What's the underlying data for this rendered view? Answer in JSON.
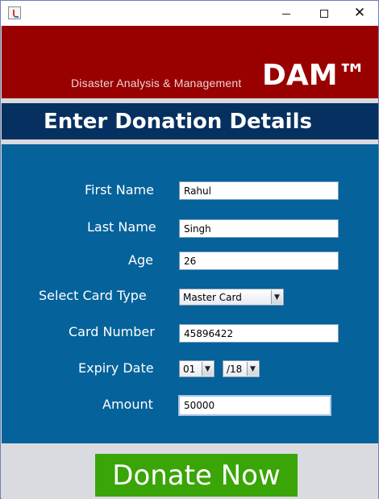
{
  "window": {
    "minimize_icon": "minimize-icon",
    "maximize_icon": "maximize-icon",
    "close_icon": "close-icon",
    "close_glyph": "✕"
  },
  "header": {
    "subtitle": "Disaster Analysis & Management",
    "logo": "DAM™",
    "color": "#990000"
  },
  "section": {
    "title": "Enter Donation Details",
    "color": "#06305f"
  },
  "form": {
    "panel_color": "#05629a",
    "first_name": {
      "label": "First Name",
      "value": "Rahul"
    },
    "last_name": {
      "label": "Last Name",
      "value": "Singh"
    },
    "age": {
      "label": "Age",
      "value": "26"
    },
    "card_type": {
      "label": "Select Card Type",
      "value": "Master Card"
    },
    "card_number": {
      "label": "Card Number",
      "value": "45896422"
    },
    "expiry": {
      "label": "Expiry Date",
      "month": "01",
      "year": "/18"
    },
    "amount": {
      "label": "Amount",
      "value": "50000"
    }
  },
  "actions": {
    "donate_label": "Donate Now",
    "donate_color": "#3aa507"
  }
}
